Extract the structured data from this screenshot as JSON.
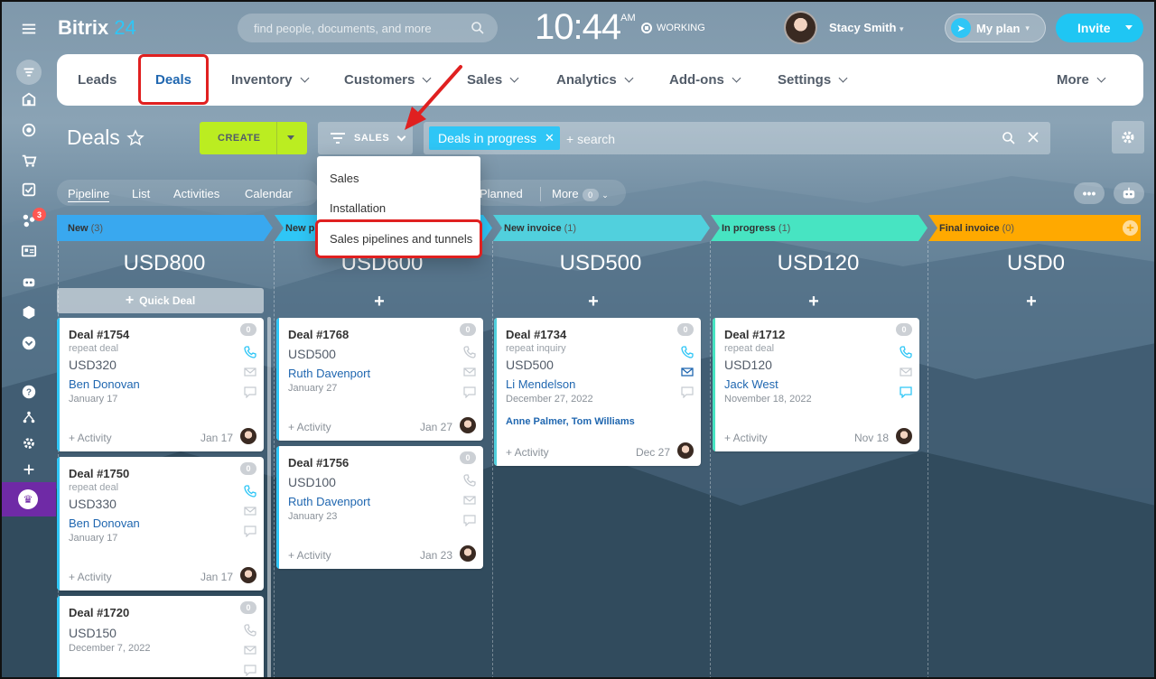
{
  "header": {
    "logo_main": "Bitrix",
    "logo_accent": "24",
    "search_placeholder": "find people, documents, and more",
    "time": "10:44",
    "ampm": "AM",
    "status": "WORKING",
    "user_name": "Stacy Smith",
    "my_plan": "My plan",
    "invite": "Invite"
  },
  "sidebar": {
    "notification_count": "3"
  },
  "nav": {
    "items": [
      {
        "label": "Leads"
      },
      {
        "label": "Deals"
      },
      {
        "label": "Inventory"
      },
      {
        "label": "Customers"
      },
      {
        "label": "Sales"
      },
      {
        "label": "Analytics"
      },
      {
        "label": "Add-ons"
      },
      {
        "label": "Settings"
      },
      {
        "label": "More"
      }
    ]
  },
  "toolbar": {
    "title": "Deals",
    "create": "CREATE",
    "pipeline": "SALES",
    "filter_tag": "Deals in progress",
    "filter_search": "+ search"
  },
  "dropdown": {
    "items": [
      "Sales",
      "Installation",
      "Sales pipelines and tunnels"
    ]
  },
  "views": {
    "tabs": [
      "Pipeline",
      "List",
      "Activities",
      "Calendar"
    ],
    "planned": "Planned",
    "more": "More",
    "more_count": "0"
  },
  "columns": [
    {
      "name": "New",
      "count": "(3)",
      "total": "USD800",
      "color": "#39a8ef"
    },
    {
      "name": "New p",
      "count": "",
      "total": "USD600",
      "color": "#2fc6f6"
    },
    {
      "name": "New invoice",
      "count": "(1)",
      "total": "USD500",
      "color": "#51d0dd"
    },
    {
      "name": "In progress",
      "count": "(1)",
      "total": "USD120",
      "color": "#47e4c2"
    },
    {
      "name": "Final invoice",
      "count": "(0)",
      "total": "USD0",
      "color": "#ffa900"
    }
  ],
  "quick_deal": "Quick Deal",
  "cards": {
    "c1754": {
      "title": "Deal #1754",
      "badge": "0",
      "sub": "repeat deal",
      "amount": "USD320",
      "contact": "Ben Donovan",
      "date": "January 17",
      "activity": "+ Activity",
      "due": "Jan 17"
    },
    "c1750": {
      "title": "Deal #1750",
      "badge": "0",
      "sub": "repeat deal",
      "amount": "USD330",
      "contact": "Ben Donovan",
      "date": "January 17",
      "activity": "+ Activity",
      "due": "Jan 17"
    },
    "c1720": {
      "title": "Deal #1720",
      "badge": "0",
      "amount": "USD150",
      "date": "December 7, 2022"
    },
    "c1768": {
      "title": "Deal #1768",
      "badge": "0",
      "amount": "USD500",
      "contact": "Ruth Davenport",
      "date": "January 27",
      "activity": "+ Activity",
      "due": "Jan 27"
    },
    "c1756": {
      "title": "Deal #1756",
      "badge": "0",
      "amount": "USD100",
      "contact": "Ruth Davenport",
      "date": "January 23",
      "activity": "+ Activity",
      "due": "Jan 23"
    },
    "c1734": {
      "title": "Deal #1734",
      "badge": "0",
      "sub": "repeat inquiry",
      "amount": "USD500",
      "contact": "Li Mendelson",
      "date": "December 27, 2022",
      "extra": "Anne Palmer, Tom Williams",
      "activity": "+ Activity",
      "due": "Dec 27"
    },
    "c1712": {
      "title": "Deal #1712",
      "badge": "0",
      "sub": "repeat deal",
      "amount": "USD120",
      "contact": "Jack West",
      "date": "November 18, 2022",
      "activity": "+ Activity",
      "due": "Nov 18"
    }
  },
  "colors": {
    "accent": "#2fc6f6",
    "create_green": "#bbed21",
    "highlight_red": "#e02020",
    "link_blue": "#2067b0"
  }
}
